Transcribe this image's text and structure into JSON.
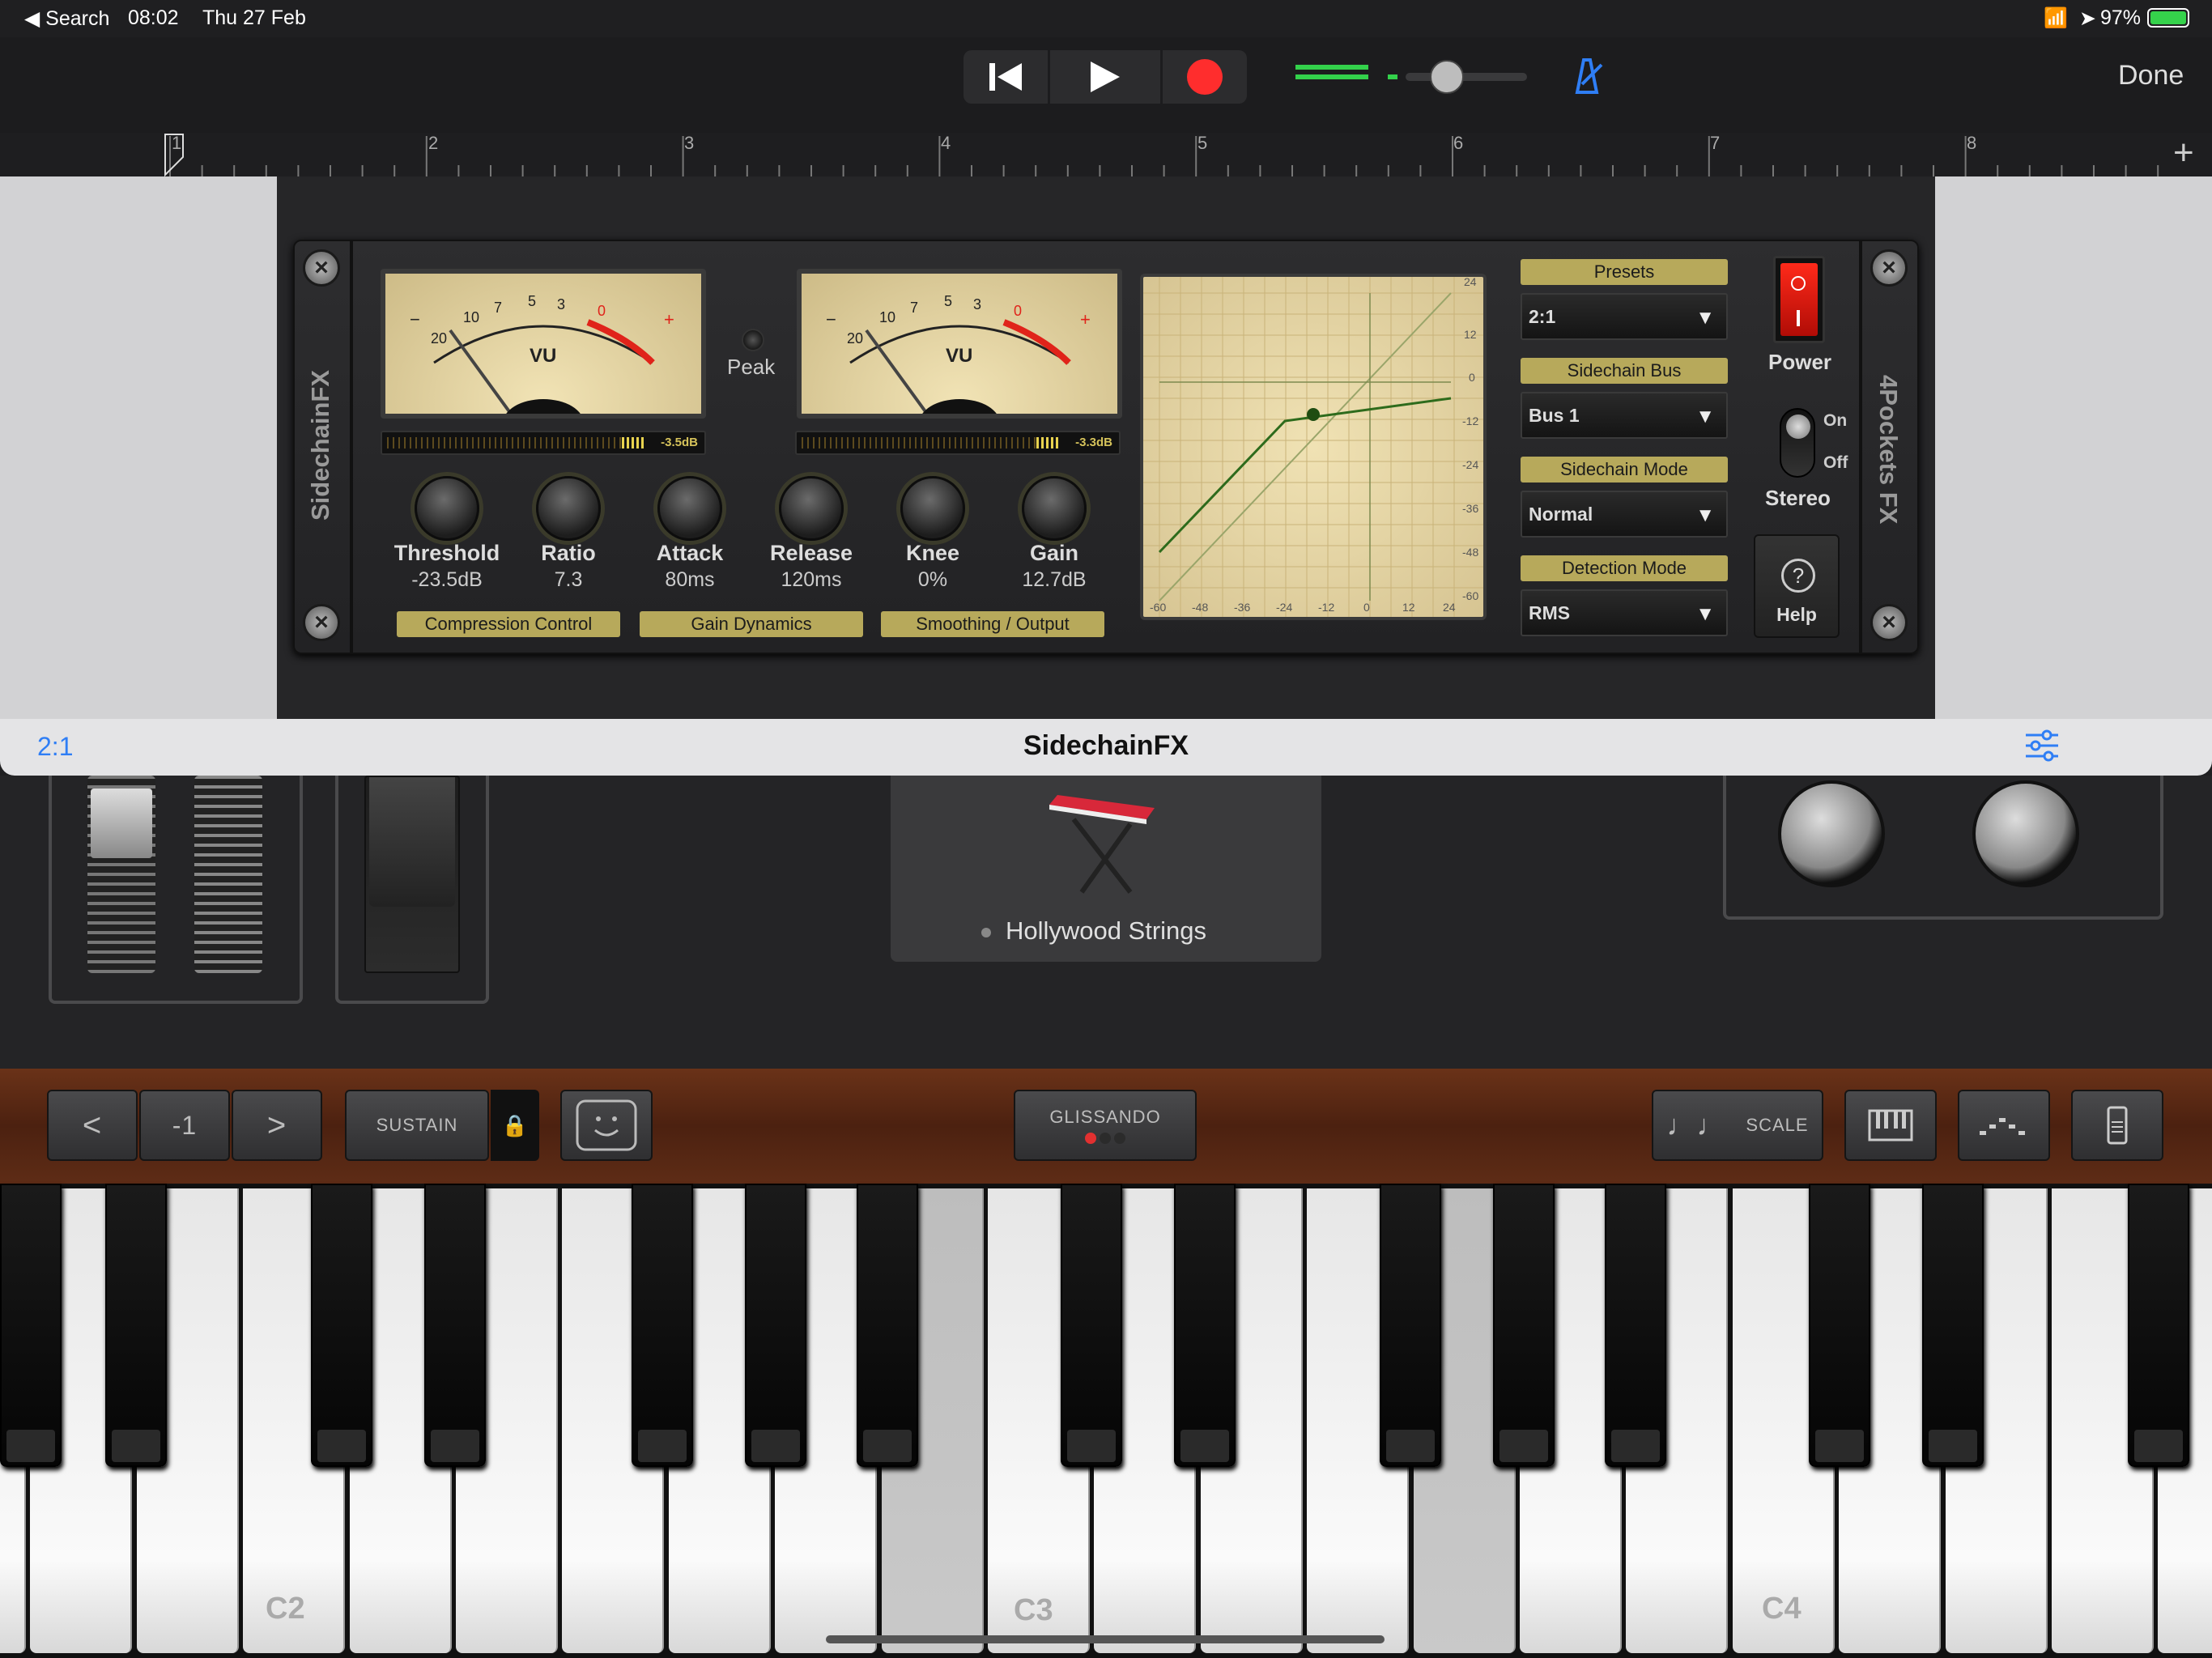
{
  "status": {
    "back": "◀ Search",
    "time": "08:02",
    "date": "Thu 27 Feb",
    "battery": "97%"
  },
  "topbar": {
    "done": "Done"
  },
  "ruler": {
    "marks": [
      "1",
      "2",
      "3",
      "4",
      "5",
      "6",
      "7",
      "8"
    ]
  },
  "plugin": {
    "name_vertical": "SidechainFX",
    "brand_vertical": "4Pockets FX",
    "vu_label": "VU",
    "vu_scale": [
      "20",
      "10",
      "7",
      "5",
      "3",
      "0",
      "+",
      "−"
    ],
    "peak_label": "Peak",
    "meter_left_value": "-3.5dB",
    "meter_right_value": "-3.3dB",
    "knobs": [
      {
        "label": "Threshold",
        "value": "-23.5dB"
      },
      {
        "label": "Ratio",
        "value": "7.3"
      },
      {
        "label": "Attack",
        "value": "80ms"
      },
      {
        "label": "Release",
        "value": "120ms"
      },
      {
        "label": "Knee",
        "value": "0%"
      },
      {
        "label": "Gain",
        "value": "12.7dB"
      }
    ],
    "sections": [
      "Compression Control",
      "Gain Dynamics",
      "Smoothing / Output"
    ],
    "graph": {
      "y_ticks": [
        "24",
        "12",
        "0",
        "-12",
        "-24",
        "-36",
        "-48",
        "-60"
      ],
      "x_ticks": [
        "-60",
        "-48",
        "-36",
        "-24",
        "-12",
        "0",
        "12",
        "24"
      ]
    },
    "presets_label": "Presets",
    "preset_value": "2:1",
    "sidechain_bus_label": "Sidechain Bus",
    "sidechain_bus_value": "Bus 1",
    "sidechain_mode_label": "Sidechain Mode",
    "sidechain_mode_value": "Normal",
    "detection_mode_label": "Detection Mode",
    "detection_mode_value": "RMS",
    "power_label": "Power",
    "stereo_on": "On",
    "stereo_off": "Off",
    "stereo_label": "Stereo",
    "help_label": "Help",
    "help_symbol": "?"
  },
  "header": {
    "preset": "2:1",
    "title": "SidechainFX"
  },
  "instrument": {
    "name": "Hollywood Strings"
  },
  "controls": {
    "prev": "<",
    "octave": "-1",
    "next": ">",
    "sustain": "SUSTAIN",
    "glissando": "GLISSANDO",
    "scale": "SCALE"
  },
  "keyboard": {
    "labels": [
      "C2",
      "C3",
      "C4"
    ]
  },
  "colors": {
    "accent": "#2f7ef5",
    "record": "#ff2d2d",
    "level": "#33d14b",
    "tag": "#b7a95b"
  }
}
